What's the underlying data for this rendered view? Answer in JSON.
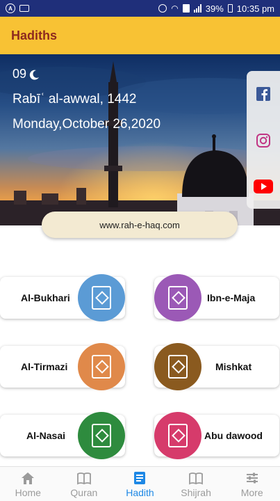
{
  "status_bar": {
    "battery": "39%",
    "time": "10:35 pm"
  },
  "header": {
    "title": "Hadiths"
  },
  "banner": {
    "hijri_day": "09",
    "hijri_month_year": "Rabīʿ al-awwal, 1442",
    "gregorian_date": "Monday,October 26,2020",
    "website": "www.rah-e-haq.com",
    "social": [
      "facebook-icon",
      "instagram-icon",
      "youtube-icon"
    ]
  },
  "collections": [
    {
      "label": "Al-Bukhari",
      "color": "#5b9bd5"
    },
    {
      "label": "Ibn-e-Maja",
      "color": "#9b59b6"
    },
    {
      "label": "Al-Tirmazi",
      "color": "#e0894a"
    },
    {
      "label": "Mishkat",
      "color": "#8a5a1f"
    },
    {
      "label": "Al-Nasai",
      "color": "#2e8b3e"
    },
    {
      "label": "Abu dawood",
      "color": "#d63b6b"
    }
  ],
  "nav": {
    "items": [
      {
        "label": "Home",
        "icon": "home-icon"
      },
      {
        "label": "Quran",
        "icon": "book-icon"
      },
      {
        "label": "Hadith",
        "icon": "hadith-icon"
      },
      {
        "label": "Shijrah",
        "icon": "book-icon"
      },
      {
        "label": "More",
        "icon": "sliders-icon"
      }
    ],
    "active": "Hadith"
  },
  "colors": {
    "header_bg": "#f8c234",
    "title": "#8e2a1f",
    "status_bar": "#1f2f7a",
    "active_nav": "#1e88e5"
  }
}
